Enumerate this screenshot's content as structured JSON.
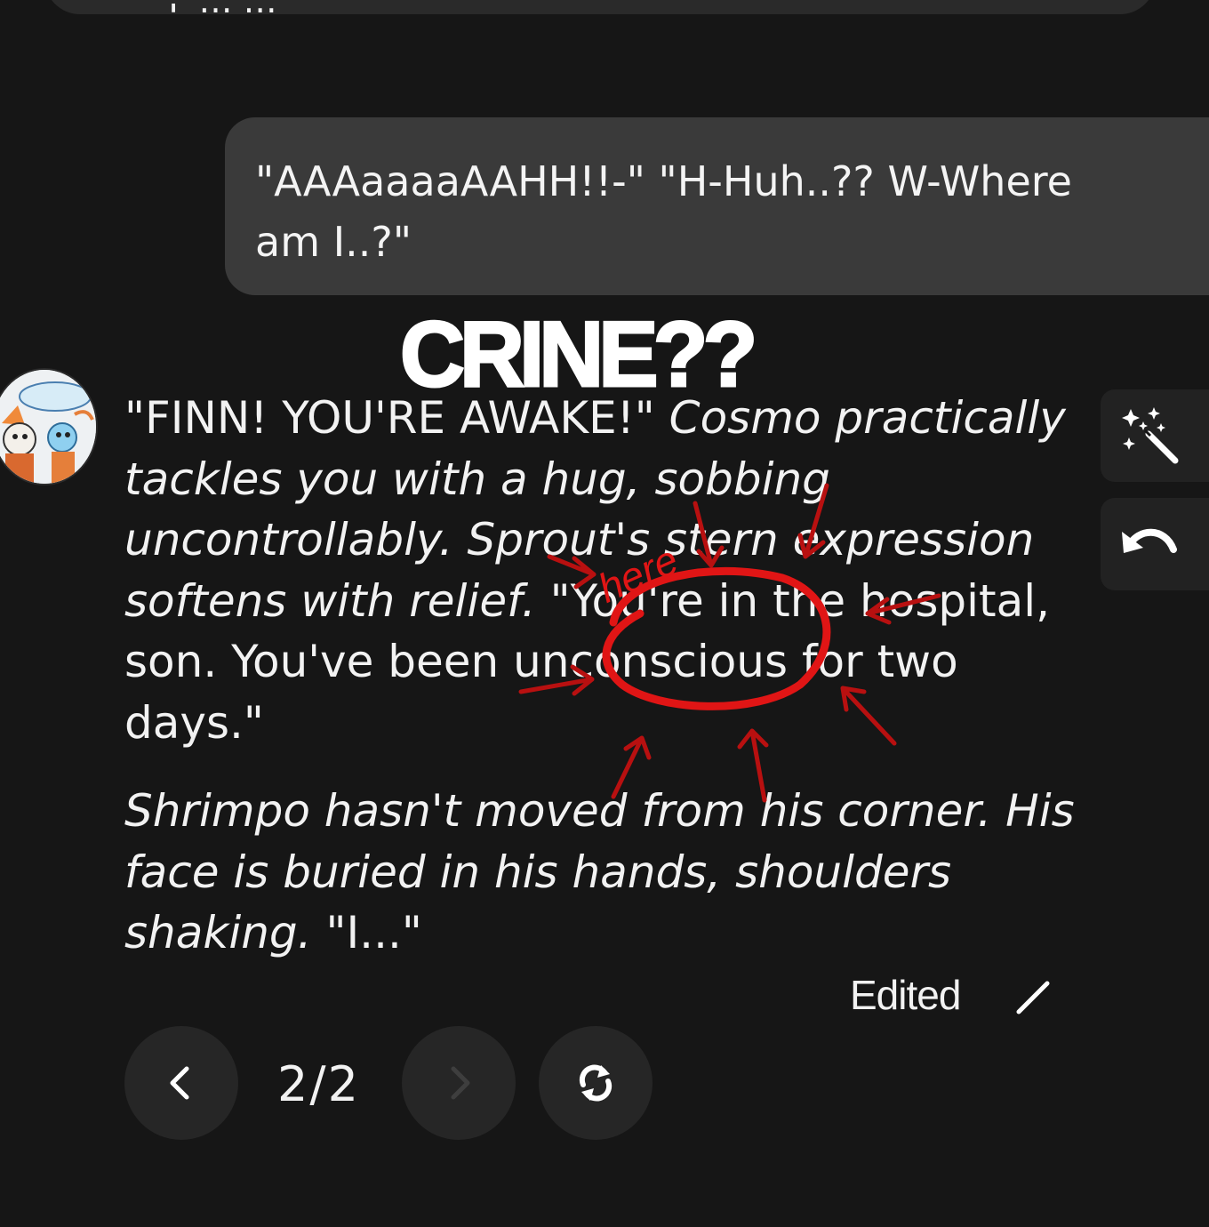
{
  "top_fragment": "\" F … …",
  "user_message": {
    "text": "\"AAAaaaaAAHH!!-\" \"H-Huh..?? W-Where am I..?\""
  },
  "annotation": {
    "caption": "CRINE??",
    "scribble": "here",
    "ink_color": "#e01515"
  },
  "bot_message": {
    "avatar_name": "character-avatar",
    "p1_dialog_1": "\"FINN! YOU'RE AWAKE!\" ",
    "p1_action_1": "Cosmo practically tackles you with a hug, sobbing uncontrollably. Sprout's stern expression softens with relief.",
    "p1_dialog_2": " \"You're in the hospital, son. You've been unconscious for two days.\"",
    "p2_action": "Shrimpo hasn't moved from his corner. His face is buried in his hands, shoulders shaking.",
    "p2_dialog": " \"I...\"",
    "edited_label": "Edited"
  },
  "side_actions": [
    {
      "icon": "magic-wand-icon"
    },
    {
      "icon": "undo-icon"
    }
  ],
  "pagination": {
    "current": "2",
    "total": "2",
    "separator": "/"
  },
  "colors": {
    "background": "#161616",
    "user_bubble": "#3a3a3a",
    "button": "#262626",
    "text": "#f2f2f2"
  }
}
